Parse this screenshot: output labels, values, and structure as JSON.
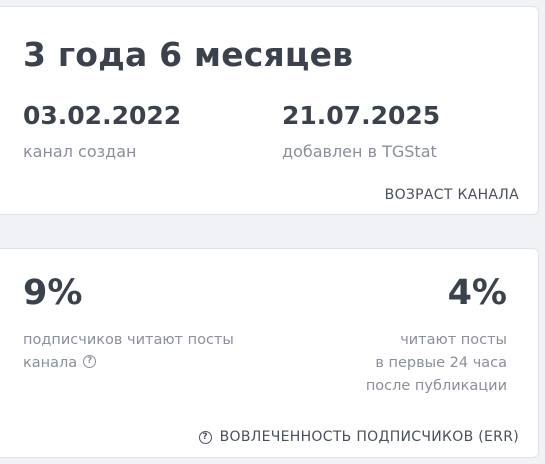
{
  "age_card": {
    "title": "3 года 6 месяцев",
    "created_date": "03.02.2022",
    "created_label": "канал создан",
    "added_date": "21.07.2025",
    "added_label": "добавлен в TGStat",
    "footer": "ВОЗРАСТ КАНАЛА"
  },
  "err_card": {
    "left_value": "9%",
    "left_caption_line1": "подписчиков читают посты",
    "left_caption_line2": "канала",
    "right_value": "4%",
    "right_caption_line1": "читают посты",
    "right_caption_line2": "в первые 24 часа",
    "right_caption_line3": "после публикации",
    "footer": "ВОВЛЕЧЕННОСТЬ ПОДПИСЧИКОВ (ERR)"
  },
  "icons": {
    "help": "?"
  }
}
